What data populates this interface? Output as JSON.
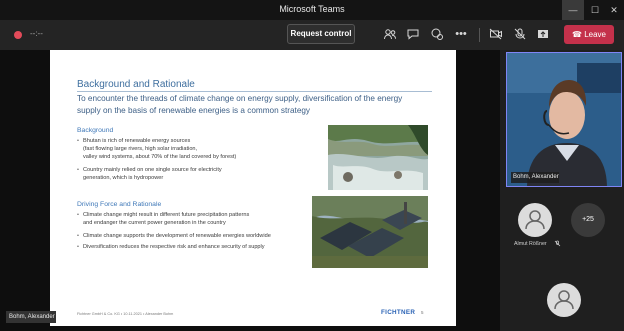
{
  "window": {
    "title": "Microsoft Teams",
    "minimize": "—",
    "maximize": "☐",
    "close": "✕"
  },
  "toolbar": {
    "timer": "--:--",
    "request_control": "Request control",
    "leave": "Leave",
    "icons": {
      "participants": "👥",
      "chat": "💬",
      "reactions": "☺",
      "more": "•••",
      "camera_off": "▰",
      "mic_off": "🎙",
      "share": "⇪",
      "leave": "☎"
    },
    "colors": {
      "leave": "#c4314b",
      "record": "#e34b5a"
    }
  },
  "slide": {
    "heading": "Background and Rationale",
    "lead": "To encounter the threads of climate change on energy supply, diversification of the energy supply on the basis of renewable energies is a common strategy",
    "sections": [
      {
        "title": "Background",
        "bullets": [
          "Bhutan is rich of renewable energy sources\n(fast flowing large rivers, high solar irradiation,\nvalley wind systems, about 70% of the land covered by forest)",
          "Country mainly relied on one single source for electricity\ngeneration, which is hydropower"
        ]
      },
      {
        "title": "Driving Force and Rationale",
        "bullets": [
          "Climate change might result in different future precipitation patterns\nand endanger the current power generation in the country",
          "Climate change supports the development of renewable energies worldwide",
          "Diversification reduces the respective risk and enhance security of supply"
        ]
      }
    ],
    "footer": "Fichtner GmbH & Co. KG • 10.11.2021 • Alexander Bohm",
    "logo": "FICHTNER",
    "page": "5",
    "bullet_char": "•"
  },
  "self_view": {
    "name": "Bohm, Alexander"
  },
  "panel": {
    "video_name": "Bohm, Alexander",
    "participant_name": "Almut Rößner",
    "more_count": "+25",
    "accent": "#7f85f5"
  }
}
